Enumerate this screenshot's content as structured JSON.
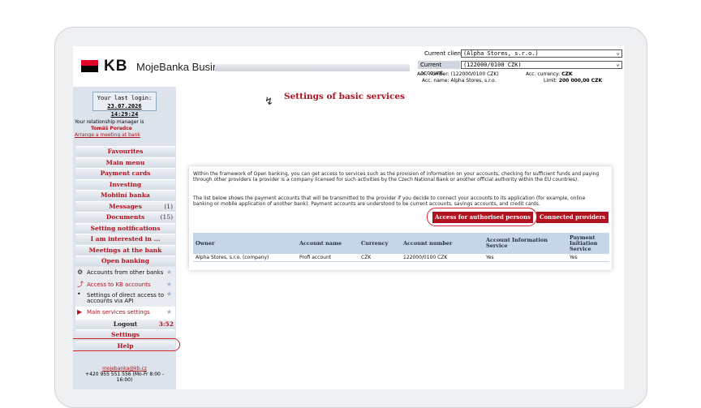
{
  "header": {
    "brand": "KB",
    "app_name": "MojeBanka Business",
    "client_label": "Current client",
    "client_value": "(Alpha Stores, s.r.o.)",
    "account_label": "Current account",
    "account_value": "(122000/0100 CZK)",
    "acc_number": "Acc. number: (122000/0100 CZK)",
    "acc_currency_label": "Acc. currency:",
    "acc_currency": "CZK",
    "acc_name": "Acc. name: Alpha Stores, s.r.o.",
    "limit_label": "Limit:",
    "limit": "200 000,00 CZK"
  },
  "sidebar": {
    "last_login_label": "Your last login:",
    "last_login": "23.07.2026 14:29:24",
    "rm_label": "Your relationship manager is",
    "rm_name": "Tomáš Poradce",
    "rm_link": "Arrange a meeting at bank",
    "items": [
      {
        "label": "Favourites"
      },
      {
        "label": "Main menu"
      },
      {
        "label": "Payment cards"
      },
      {
        "label": "Investing"
      },
      {
        "label": "Mobilní banka"
      },
      {
        "label": "Messages",
        "count": "(1)"
      },
      {
        "label": "Documents",
        "count": "(15)"
      },
      {
        "label": "Setting notifications"
      },
      {
        "label": "I am interested in ..."
      },
      {
        "label": "Meetings at the bank"
      },
      {
        "label": "Open banking"
      }
    ],
    "sub_items": [
      {
        "label": "Accounts from other banks"
      },
      {
        "label": "Access to KB accounts"
      },
      {
        "label": "Settings of direct access to accounts via API"
      },
      {
        "label": "Main services settings"
      }
    ],
    "logout": "Logout",
    "logout_timer": "3:52",
    "settings": "Settings",
    "help": "Help",
    "footer_email": "mojebanka@kb.cz",
    "footer_phone": "+420 955 551 556 (Mo-Fr 8:00 - 16:00)"
  },
  "main": {
    "title": "Settings of basic services",
    "para1": "Within the framework of Open banking, you can get access to services such as the provision of information on your accounts, checking for sufficient funds and paying through other providers (a provider is a company licensed for such activities by the Czech National Bank or another official authority within the EU countries).",
    "para2": "The list below shows the payment accounts that will be transmitted to the provider if you decide to connect your accounts to its application (for example, online banking or mobile application of another bank). Payment accounts are understood to be current accounts, savings accounts, and credit cards.",
    "btn_access": "Access for authorised persons",
    "btn_connected": "Connected providers",
    "table": {
      "headers": [
        "Owner",
        "Account name",
        "Currency",
        "Account number",
        "Account Information Service",
        "Payment Initiation Service"
      ],
      "rows": [
        [
          "Alpha Stores, s.r.o. (company)",
          "Profi account",
          "CZK",
          "122000/0100 CZK",
          "Yes",
          "Yes"
        ]
      ]
    }
  }
}
